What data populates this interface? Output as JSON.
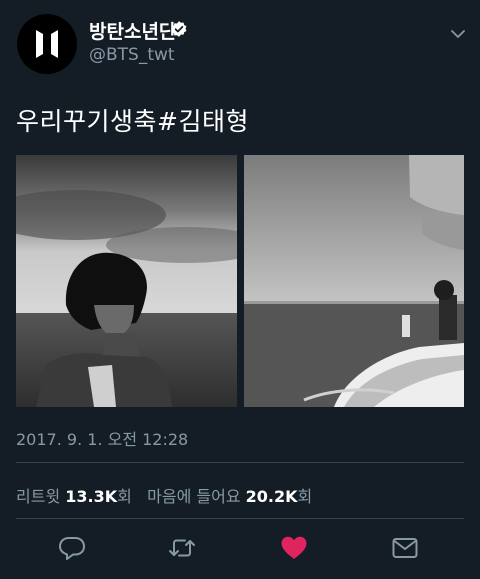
{
  "author": {
    "display_name": "방탄소년단",
    "handle": "@BTS_twt",
    "verified": true,
    "avatar_icon": "bts-logo-icon"
  },
  "tweet": {
    "text": "우리꾸기생축#김태형",
    "timestamp": "2017. 9. 1. 오전 12:28",
    "images": [
      "black-and-white portrait photo",
      "black-and-white seaside balcony photo"
    ]
  },
  "stats": {
    "retweets_label": "리트윗",
    "retweets_count": "13.3K",
    "retweets_unit": "회",
    "likes_label": "마음에 들어요",
    "likes_count": "20.2K",
    "likes_unit": "회"
  },
  "actions": {
    "reply_icon": "reply-icon",
    "retweet_icon": "retweet-icon",
    "like_icon": "heart-icon",
    "dm_icon": "envelope-icon"
  },
  "colors": {
    "background": "#141d26",
    "secondary_text": "#8899a6",
    "divider": "#38444d",
    "verified_blue": "#ffffff",
    "like_active": "#e0245e"
  }
}
